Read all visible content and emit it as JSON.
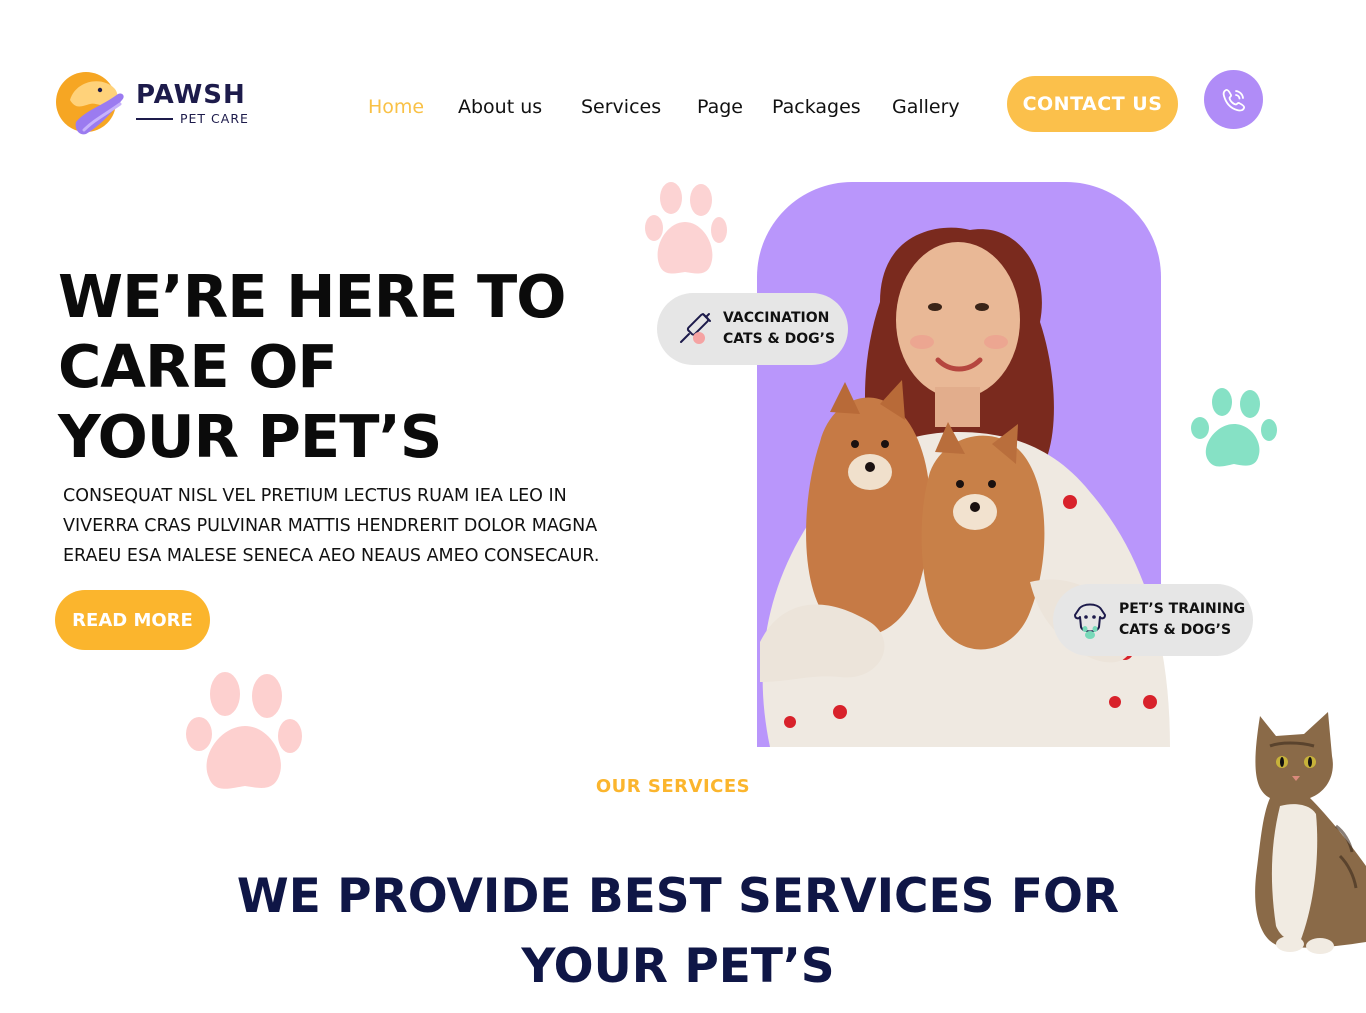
{
  "logo": {
    "title": "PAWSH",
    "subtitle": "PET CARE"
  },
  "nav": {
    "items": [
      {
        "label": "Home",
        "active": true
      },
      {
        "label": "About us",
        "active": false
      },
      {
        "label": "Services",
        "active": false
      },
      {
        "label": "Page",
        "active": false
      },
      {
        "label": "Packages",
        "active": false
      },
      {
        "label": "Gallery",
        "active": false
      }
    ],
    "contact_label": "CONTACT US",
    "phone_icon": "phone-icon"
  },
  "hero": {
    "title_lines": [
      "WE’RE HERE TO",
      "CARE OF",
      "YOUR PET’S"
    ],
    "description_lines": [
      "CONSEQUAT NISL VEL PRETIUM LECTUS RUAM IEA LEO IN",
      "VIVERRA CRAS PULVINAR MATTIS HENDRERIT DOLOR MAGNA",
      "ERAEU ESA MALESE SENECA AEO NEAUS AMEO CONSECAUR."
    ],
    "read_more_label": "READ MORE",
    "badges": {
      "vaccination": {
        "line1": "VACCINATION",
        "line2": "CATS & DOG’S",
        "icon": "syringe-icon"
      },
      "training": {
        "line1": "PET’S TRAINING",
        "line2": "CATS & DOG’S",
        "icon": "dog-training-icon"
      }
    }
  },
  "services": {
    "label": "OUR SERVICES",
    "title_lines": [
      "WE PROVIDE BEST SERVICES FOR",
      "YOUR PET’S"
    ]
  },
  "colors": {
    "accent_yellow": "#fbb52d",
    "accent_purple": "#b08cf7",
    "navy": "#0f1646",
    "paw_pink": "#fdd0d0",
    "paw_mint": "#84e0c4"
  }
}
